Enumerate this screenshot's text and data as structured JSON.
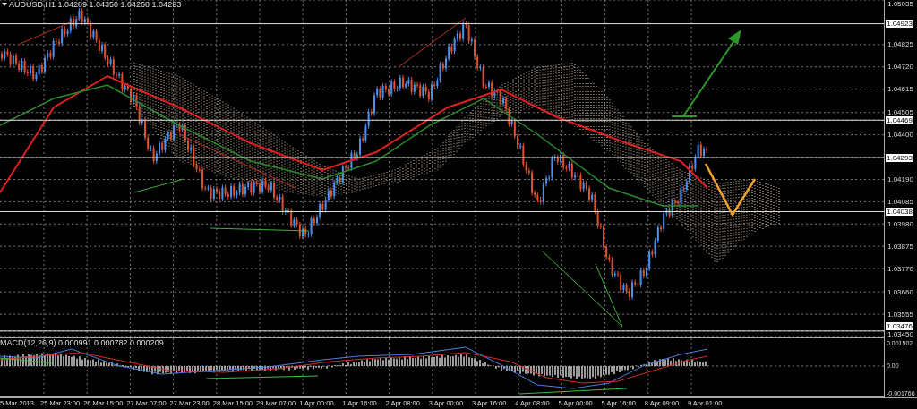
{
  "chart": {
    "title": "AUDUSD,H1 1.04289 1.04350 1.04268 1.04293",
    "price_labels": [
      {
        "text": "1.05035",
        "kind": "tick"
      },
      {
        "text": "1.04923",
        "kind": "level_line"
      },
      {
        "text": "1.04825",
        "kind": "tick"
      },
      {
        "text": "1.04720",
        "kind": "tick"
      },
      {
        "text": "1.04615",
        "kind": "tick"
      },
      {
        "text": "1.04505",
        "kind": "tick"
      },
      {
        "text": "1.04469",
        "kind": "level_line"
      },
      {
        "text": "1.04400",
        "kind": "tick"
      },
      {
        "text": "1.04293",
        "kind": "level_line"
      },
      {
        "text": "1.04190",
        "kind": "tick"
      },
      {
        "text": "1.04085",
        "kind": "tick"
      },
      {
        "text": "1.04038",
        "kind": "level_line"
      },
      {
        "text": "1.03980",
        "kind": "tick"
      },
      {
        "text": "1.03875",
        "kind": "tick"
      },
      {
        "text": "1.03770",
        "kind": "tick"
      },
      {
        "text": "1.03660",
        "kind": "tick"
      },
      {
        "text": "1.03555",
        "kind": "tick"
      },
      {
        "text": "1.03476",
        "kind": "level_line"
      },
      {
        "text": "1.03450",
        "kind": "tick"
      }
    ]
  },
  "macd": {
    "title": "MACD(12,26,9) 0.000991 0.000782 0.000209",
    "scale_labels": [
      "0.001502",
      "0.00",
      "-0.001766"
    ]
  },
  "time_axis": [
    "5 Mar 2013",
    "25 Mar 23:00",
    "26 Mar 15:00",
    "27 Mar 07:00",
    "27 Mar 23:00",
    "28 Mar 15:00",
    "29 Mar 07:00",
    "1 Apr 00:00",
    "1 Apr 16:00",
    "2 Apr 08:00",
    "3 Apr 00:00",
    "3 Apr 16:00",
    "4 Apr 08:00",
    "5 Apr 00:00",
    "5 Apr 16:00",
    "8 Apr 09:00",
    "9 Apr 01:00"
  ]
}
